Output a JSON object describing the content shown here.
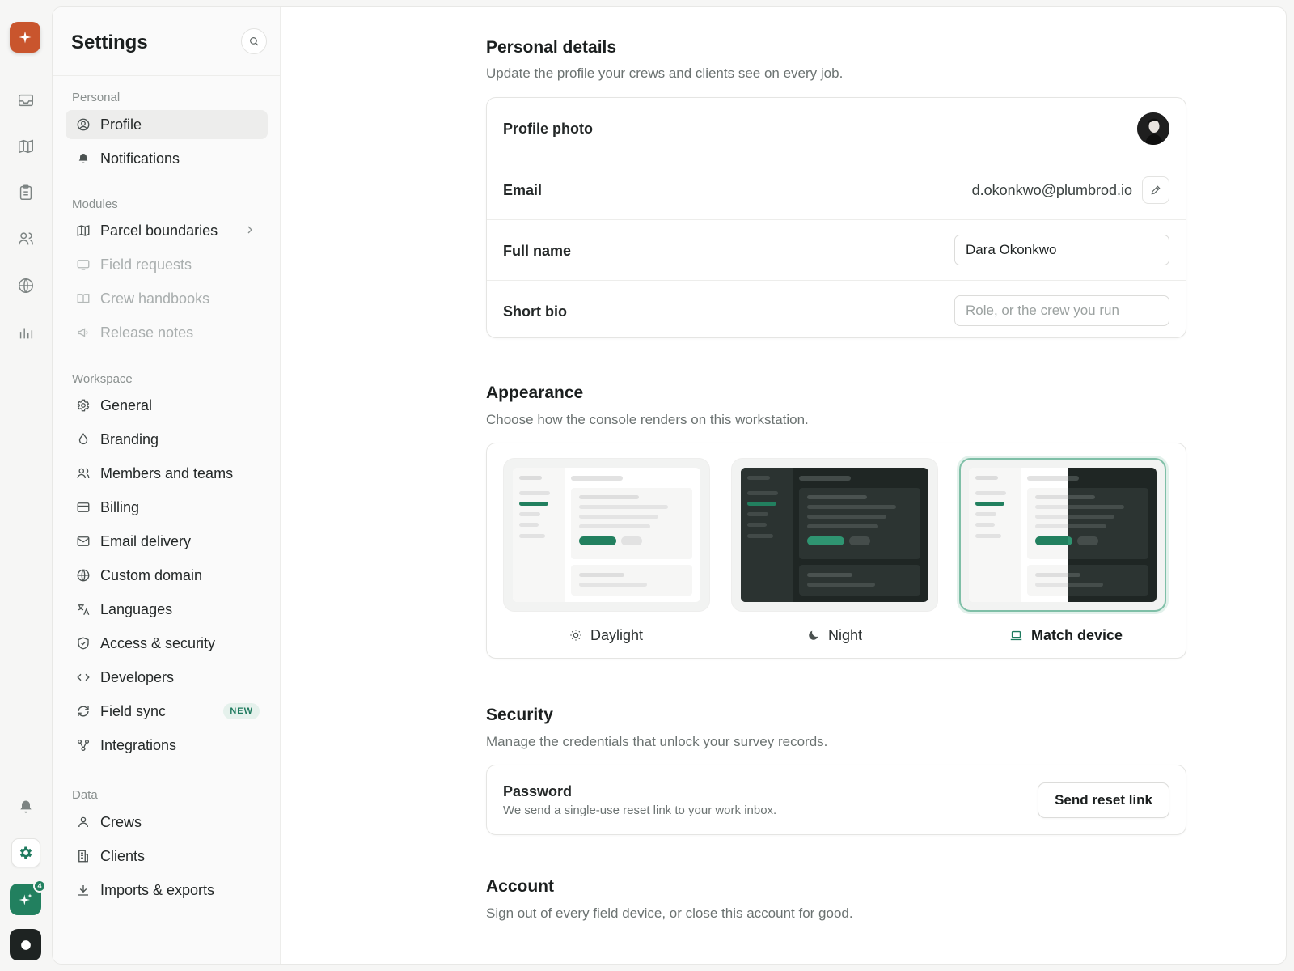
{
  "colors": {
    "accent": "#22805f",
    "brand": "#c9552d",
    "badge_bg": "#e5f1ec",
    "text_primary": "#1b1f1f",
    "text_muted": "#6c7372"
  },
  "rail": {
    "logo_icon": "sparkle-icon",
    "nav_icons": [
      "inbox-icon",
      "map-icon",
      "clipboard-icon",
      "users-icon",
      "globe-icon",
      "bar-chart-icon"
    ],
    "bottom_icons": [
      "bell-icon",
      "gear-icon",
      "sparkle-assistant-icon",
      "user-avatar-icon"
    ],
    "assistant_badge": "4"
  },
  "sidebar": {
    "title": "Settings",
    "search_icon": "search-icon",
    "groups": {
      "personal": "Personal",
      "modules": "Modules",
      "workspace": "Workspace",
      "data": "Data"
    },
    "personal": [
      {
        "label": "Profile",
        "icon": "user-circle-icon",
        "active": true
      },
      {
        "label": "Notifications",
        "icon": "bell-icon"
      }
    ],
    "modules": [
      {
        "label": "Parcel boundaries",
        "icon": "map-icon",
        "chevron": true
      },
      {
        "label": "Field requests",
        "icon": "monitor-icon",
        "disabled": true
      },
      {
        "label": "Crew handbooks",
        "icon": "book-icon",
        "disabled": true
      },
      {
        "label": "Release notes",
        "icon": "megaphone-icon",
        "disabled": true
      }
    ],
    "workspace": [
      {
        "label": "General",
        "icon": "gear-icon"
      },
      {
        "label": "Branding",
        "icon": "droplet-icon"
      },
      {
        "label": "Members and teams",
        "icon": "users-icon"
      },
      {
        "label": "Billing",
        "icon": "credit-card-icon"
      },
      {
        "label": "Email delivery",
        "icon": "mail-icon"
      },
      {
        "label": "Custom domain",
        "icon": "globe-icon"
      },
      {
        "label": "Languages",
        "icon": "translate-icon"
      },
      {
        "label": "Access & security",
        "icon": "shield-icon"
      },
      {
        "label": "Developers",
        "icon": "code-icon"
      },
      {
        "label": "Field sync",
        "icon": "sync-icon",
        "badge": "NEW"
      },
      {
        "label": "Integrations",
        "icon": "integrations-icon"
      }
    ],
    "data": [
      {
        "label": "Crews",
        "icon": "user-icon"
      },
      {
        "label": "Clients",
        "icon": "building-icon"
      },
      {
        "label": "Imports & exports",
        "icon": "download-icon"
      }
    ]
  },
  "personal_details": {
    "title": "Personal details",
    "description": "Update the profile your crews and clients see on every job.",
    "photo_label": "Profile photo",
    "email_label": "Email",
    "email_value": "d.okonkwo@plumbrod.io",
    "full_name_label": "Full name",
    "full_name_value": "Dara Okonkwo",
    "bio_label": "Short bio",
    "bio_placeholder": "Role, or the crew you run"
  },
  "appearance": {
    "title": "Appearance",
    "description": "Choose how the console renders on this workstation.",
    "options": [
      {
        "label": "Daylight",
        "icon": "sun-icon"
      },
      {
        "label": "Night",
        "icon": "moon-icon"
      },
      {
        "label": "Match device",
        "icon": "laptop-icon",
        "selected": true
      }
    ]
  },
  "security": {
    "title": "Security",
    "description": "Manage the credentials that unlock your survey records.",
    "password_label": "Password",
    "password_description": "We send a single-use reset link to your work inbox.",
    "reset_button": "Send reset link"
  },
  "account": {
    "title": "Account",
    "description": "Sign out of every field device, or close this account for good."
  }
}
